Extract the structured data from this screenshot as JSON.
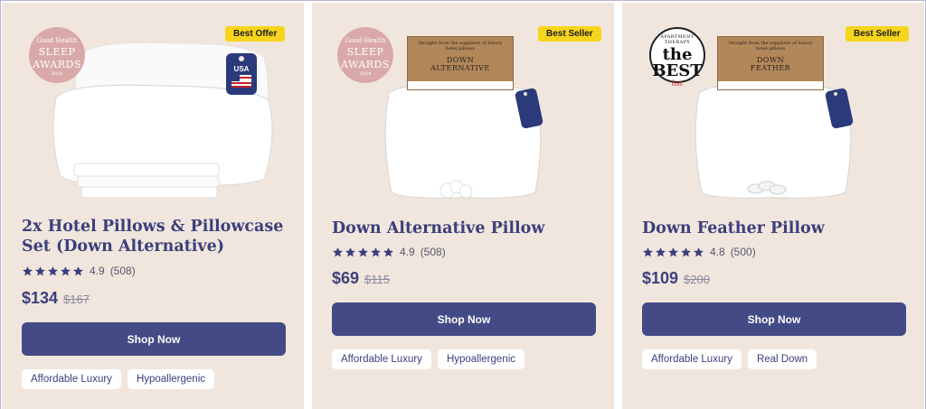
{
  "products": [
    {
      "badge": "Best Offer",
      "title": "2x Hotel Pillows & Pillowcase Set (Down Alternative)",
      "rating": "4.9",
      "reviews": "(508)",
      "price": "$134",
      "old_price": "$167",
      "button_label": "Shop Now",
      "tags": [
        "Affordable Luxury",
        "Hypoallergenic"
      ],
      "award": {
        "line1": "Good Health",
        "line2": "SLEEP",
        "line3": "AWARDS",
        "year": "2024"
      },
      "tag_label": "USA"
    },
    {
      "badge": "Best Seller",
      "title": "Down Alternative Pillow",
      "rating": "4.9",
      "reviews": "(508)",
      "price": "$69",
      "old_price": "$115",
      "button_label": "Shop Now",
      "tags": [
        "Affordable Luxury",
        "Hypoallergenic"
      ],
      "award": {
        "line1": "Good Health",
        "line2": "SLEEP",
        "line3": "AWARDS",
        "year": "2024"
      },
      "box": {
        "top": "Straight from the suppliers of luxury hotel pillows",
        "name1": "DOWN",
        "name2": "ALTERNATIVE"
      }
    },
    {
      "badge": "Best Seller",
      "title": "Down Feather Pillow",
      "rating": "4.8",
      "reviews": "(500)",
      "price": "$109",
      "old_price": "$200",
      "button_label": "Shop Now",
      "tags": [
        "Affordable Luxury",
        "Real Down"
      ],
      "award": {
        "line1": "APARTMENT THERAPY",
        "line2": "the BEST",
        "line3": "list"
      },
      "box": {
        "top": "Straight from the suppliers of luxury hotel pillows",
        "name1": "DOWN",
        "name2": "FEATHER"
      }
    }
  ],
  "colors": {
    "card_bg": "#f1e6dd",
    "accent": "#444a85",
    "title": "#3b3f7d",
    "badge": "#f7d51c",
    "stars": "#3b3f7d"
  }
}
